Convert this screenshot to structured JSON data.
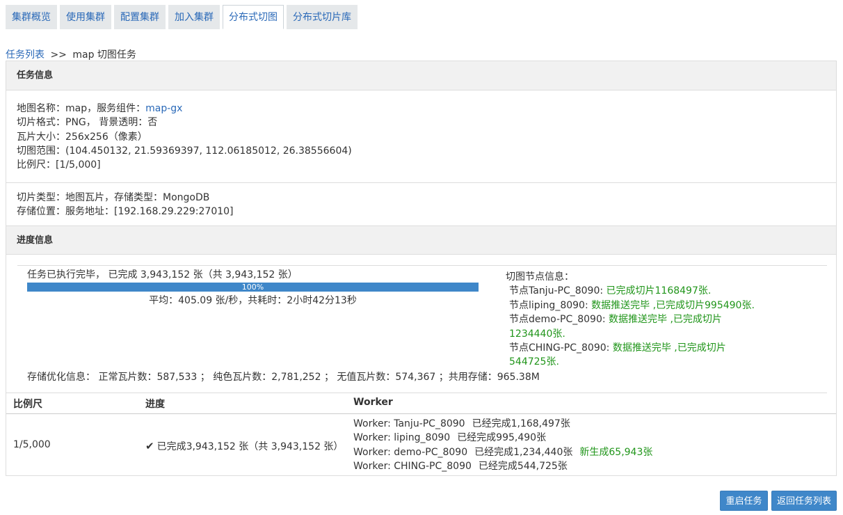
{
  "tabs": [
    {
      "label": "集群概览",
      "active": false
    },
    {
      "label": "使用集群",
      "active": false
    },
    {
      "label": "配置集群",
      "active": false
    },
    {
      "label": "加入集群",
      "active": false
    },
    {
      "label": "分布式切图",
      "active": true
    },
    {
      "label": "分布式切片库",
      "active": false
    }
  ],
  "breadcrumb": {
    "link": "任务列表",
    "separator": ">>",
    "current": "map 切图任务"
  },
  "task_info": {
    "header": "任务信息",
    "map_name_prefix": "地图名称：map，服务组件：",
    "service_link": "map-gx",
    "tile_format": "切片格式：PNG， 背景透明：否",
    "tile_size": "瓦片大小：256x256（像素）",
    "extent": "切图范围：(104.450132, 21.59369397, 112.06185012, 26.38556604)",
    "scale": "比例尺：[1/5,000]",
    "tile_type": "切片类型：地图瓦片，存储类型：MongoDB",
    "storage": "存储位置：服务地址：[192.168.29.229:27010]"
  },
  "progress_info": {
    "header": "进度信息",
    "status": "任务已执行完毕， 已完成 3,943,152 张（共 3,943,152 张）",
    "percent_label": "100%",
    "percent": 100,
    "average": "平均：405.09 张/秒，共耗时：2小时42分13秒",
    "nodes_title": "切图节点信息：",
    "nodes": [
      {
        "name": "节点Tanju-PC_8090: ",
        "status": "已完成切片1168497张."
      },
      {
        "name": "节点liping_8090: ",
        "status": "数据推送完毕 ,已完成切片995490张."
      },
      {
        "name": "节点demo-PC_8090: ",
        "status": "数据推送完毕 ,已完成切片",
        "status2": "1234440张."
      },
      {
        "name": "节点CHING-PC_8090: ",
        "status": "数据推送完毕 ,已完成切片",
        "status2": "544725张."
      }
    ],
    "optimization": "存储优化信息： 正常瓦片数：587,533 ； 纯色瓦片数：2,781,252 ； 无值瓦片数：574,367 ；共用存储：965.38M"
  },
  "table": {
    "headers": [
      "比例尺",
      "进度",
      "Worker"
    ],
    "scale": "1/5,000",
    "progress": "已完成3,943,152 张（共 3,943,152 张）",
    "workers": [
      {
        "name": "Worker: Tanju-PC_8090",
        "done": "已经完成1,168,497张",
        "new": ""
      },
      {
        "name": "Worker: liping_8090",
        "done": "已经完成995,490张",
        "new": ""
      },
      {
        "name": "Worker: demo-PC_8090",
        "done": "已经完成1,234,440张",
        "new": "新生成65,943张"
      },
      {
        "name": "Worker: CHING-PC_8090",
        "done": "已经完成544,725张",
        "new": ""
      }
    ]
  },
  "buttons": {
    "restart": "重启任务",
    "back": "返回任务列表"
  },
  "colors": {
    "link": "#2a69b8",
    "primary": "#3f87c9",
    "success": "#20951a"
  }
}
